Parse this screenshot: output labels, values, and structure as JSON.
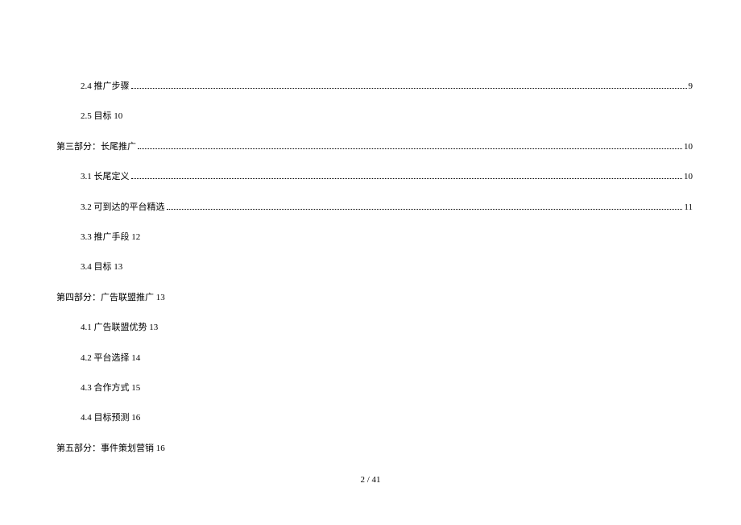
{
  "toc": [
    {
      "level": 2,
      "title": "2.4 推广步骤",
      "page": "9",
      "dotted": true
    },
    {
      "level": 2,
      "title": "2.5 目标 10",
      "page": "",
      "dotted": false
    },
    {
      "level": 1,
      "title": "第三部分：长尾推广",
      "page": "10",
      "dotted": true
    },
    {
      "level": 2,
      "title": "3.1 长尾定义",
      "page": "10",
      "dotted": true
    },
    {
      "level": 2,
      "title": "3.2 可到达的平台精选",
      "page": "11",
      "dotted": true
    },
    {
      "level": 2,
      "title": "3.3 推广手段 12",
      "page": "",
      "dotted": false
    },
    {
      "level": 2,
      "title": "3.4 目标 13",
      "page": "",
      "dotted": false
    },
    {
      "level": 1,
      "title": "第四部分：广告联盟推广 13",
      "page": "",
      "dotted": false
    },
    {
      "level": 2,
      "title": "4.1 广告联盟优势 13",
      "page": "",
      "dotted": false
    },
    {
      "level": 2,
      "title": "4.2 平台选择 14",
      "page": "",
      "dotted": false
    },
    {
      "level": 2,
      "title": "4.3 合作方式 15",
      "page": "",
      "dotted": false
    },
    {
      "level": 2,
      "title": "4.4 目标预测 16",
      "page": "",
      "dotted": false
    },
    {
      "level": 1,
      "title": "第五部分：事件策划营销 16",
      "page": "",
      "dotted": false
    }
  ],
  "footer": "2 / 41"
}
